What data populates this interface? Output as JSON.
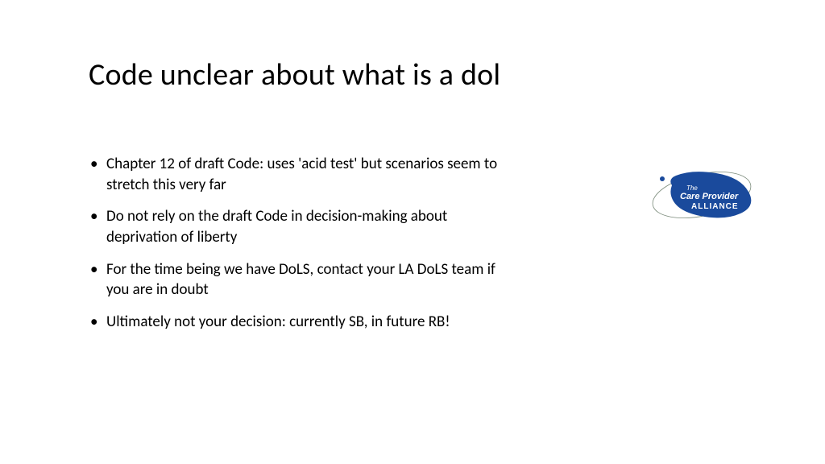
{
  "title": "Code unclear about what is a dol",
  "bullets": [
    "Chapter 12 of draft Code: uses 'acid test' but scenarios seem to stretch this very far",
    "Do not rely on the draft Code in decision-making about deprivation of liberty",
    "For the time being we have DoLS, contact your LA DoLS team if you are in doubt",
    "Ultimately not your decision: currently SB, in future RB!"
  ],
  "logo": {
    "text_line1": "The",
    "text_line2": "Care Provider",
    "text_line3": "ALLIANCE",
    "primary_color": "#1a4a9c",
    "stroke_color": "#7a8a7a"
  }
}
